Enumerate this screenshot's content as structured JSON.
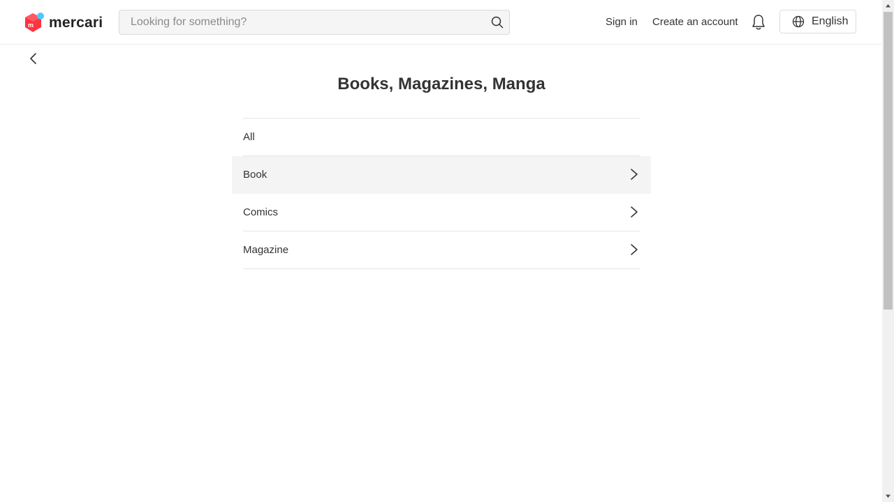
{
  "header": {
    "logo_text": "mercari",
    "search_placeholder": "Looking for something?",
    "search_value": "",
    "sign_in": "Sign in",
    "create_account": "Create an account",
    "language": "English"
  },
  "page": {
    "title": "Books, Magazines, Manga"
  },
  "categories": [
    {
      "label": "All",
      "has_chevron": false
    },
    {
      "label": "Book",
      "has_chevron": true,
      "highlighted": true
    },
    {
      "label": "Comics",
      "has_chevron": true
    },
    {
      "label": "Magazine",
      "has_chevron": true
    }
  ],
  "icons": {
    "logo": "mercari-logo-icon",
    "search": "search-icon",
    "notifications": "bell-icon",
    "language": "globe-icon",
    "back": "chevron-left-icon",
    "row": "chevron-right-icon"
  },
  "colors": {
    "brand_red": "#ff333f",
    "brand_blue": "#4dc9ff",
    "text": "#333333",
    "divider": "#e6e6e6",
    "hover_bg": "#f4f4f4"
  }
}
